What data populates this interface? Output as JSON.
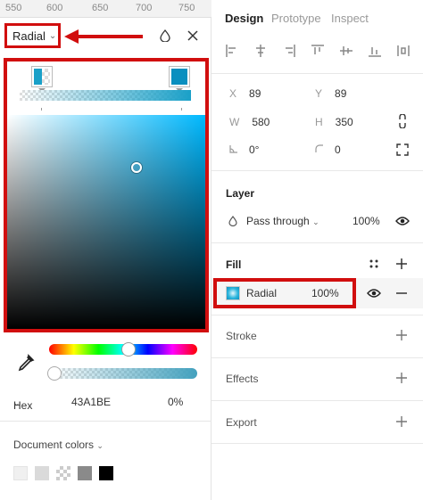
{
  "ruler": {
    "ticks": [
      "550",
      "600",
      "650",
      "700",
      "750"
    ]
  },
  "picker": {
    "type_label": "Radial",
    "hex_label": "Hex",
    "hex_value": "43A1BE",
    "opacity": "0%",
    "doc_colors_label": "Document colors",
    "swatches": [
      "#f0f0f0",
      "#dadada",
      "checker",
      "#8a8a8a",
      "#000000"
    ]
  },
  "props": {
    "tabs": [
      "Design",
      "Prototype",
      "Inspect"
    ],
    "x_label": "X",
    "x_value": "89",
    "y_label": "Y",
    "y_value": "89",
    "w_label": "W",
    "w_value": "580",
    "h_label": "H",
    "h_value": "350",
    "rotation": "0°",
    "radius": "0",
    "layer_title": "Layer",
    "blend_mode": "Pass through",
    "layer_opacity": "100%",
    "fill_title": "Fill",
    "fill_type": "Radial",
    "fill_opacity": "100%",
    "stroke_title": "Stroke",
    "effects_title": "Effects",
    "export_title": "Export"
  },
  "colors": {
    "annotation": "#d10e0e",
    "accent": "#43A1BE"
  }
}
